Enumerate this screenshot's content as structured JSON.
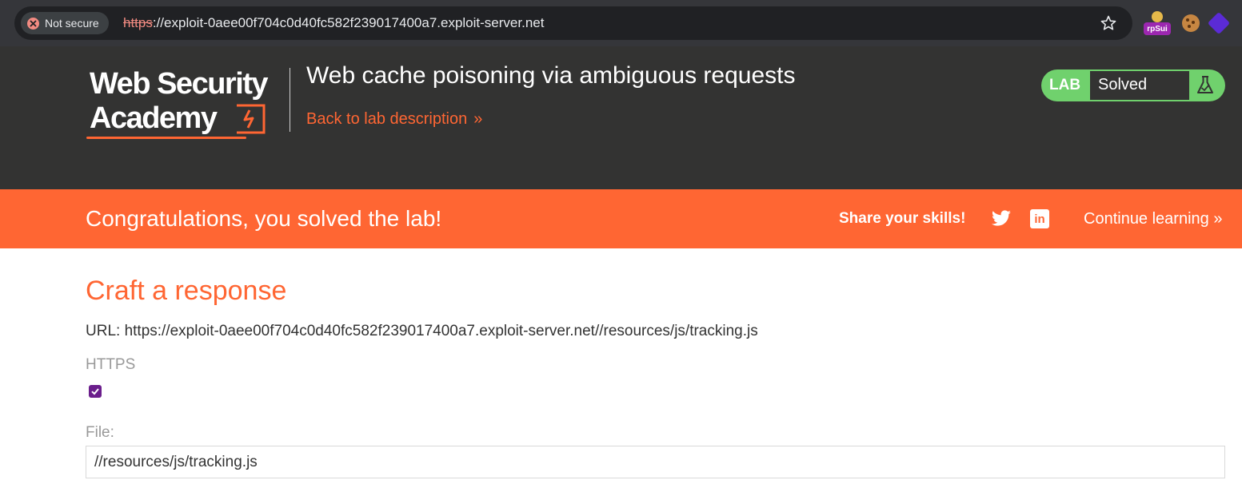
{
  "browser": {
    "security_label": "Not secure",
    "url_scheme": "https",
    "url_rest": "://exploit-0aee00f704c0d40fc582f239017400a7.exploit-server.net",
    "extensions": [
      "burp-suite-icon",
      "cookie-icon",
      "cube-icon"
    ],
    "burp_badge": "rpSui"
  },
  "header": {
    "logo_line1": "Web Security",
    "logo_line2": "Academy",
    "lab_title": "Web cache poisoning via ambiguous requests",
    "back_link": "Back to lab description",
    "back_chevron": "»",
    "lab_badge": "LAB",
    "lab_status": "Solved"
  },
  "banner": {
    "message": "Congratulations, you solved the lab!",
    "share_label": "Share your skills!",
    "continue_label": "Continue learning",
    "continue_chevron": "»"
  },
  "form": {
    "title": "Craft a response",
    "url_line": "URL: https://exploit-0aee00f704c0d40fc582f239017400a7.exploit-server.net//resources/js/tracking.js",
    "https_label": "HTTPS",
    "https_checked": true,
    "file_label": "File:",
    "file_value": "//resources/js/tracking.js"
  },
  "colors": {
    "brand_orange": "#ff6633",
    "header_dark": "#333332",
    "solved_green": "#70d16d",
    "checkbox_purple": "#6b1e8c"
  }
}
